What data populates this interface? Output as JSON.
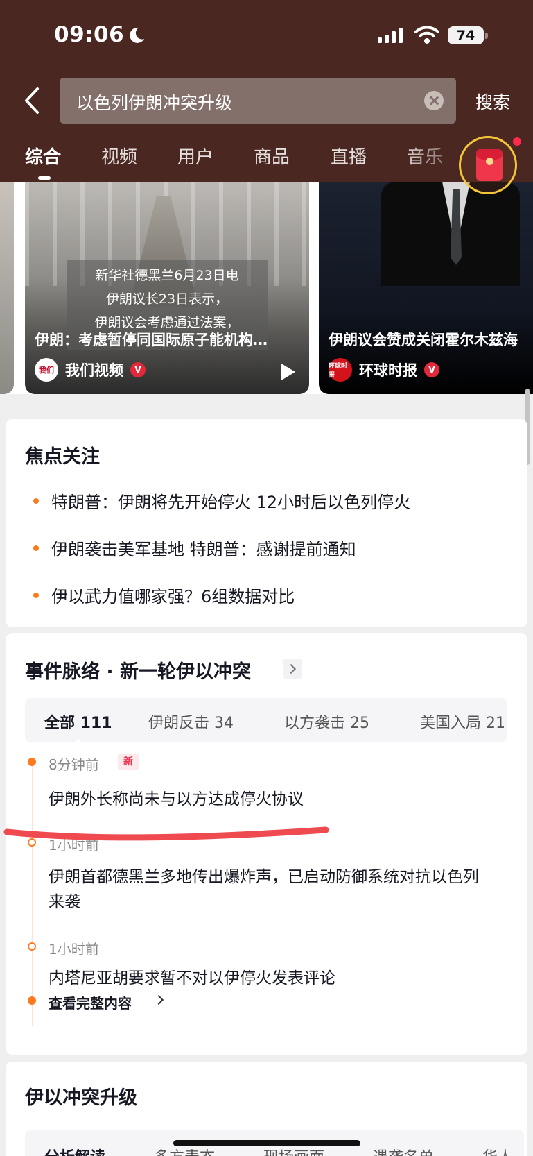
{
  "status_bar": {
    "time": "09:06",
    "battery": "74"
  },
  "search": {
    "query": "以色列伊朗冲突升级",
    "search_label": "搜索"
  },
  "tabs": [
    {
      "label": "综合",
      "active": true
    },
    {
      "label": "视频"
    },
    {
      "label": "用户"
    },
    {
      "label": "商品"
    },
    {
      "label": "直播"
    },
    {
      "label": "音乐"
    }
  ],
  "videos": [
    {
      "subtitles": [
        "新华社德黑兰6月23日电",
        "伊朗议长23日表示，",
        "伊朗议会考虑通过法案，"
      ],
      "title": "伊朗：考虑暂停同国际原子能机构…",
      "author": "我们视频",
      "avatar_text": "我们"
    },
    {
      "title": "伊朗议会赞成关闭霍尔木兹海",
      "author": "环球时报",
      "avatar_text": "环球时报"
    }
  ],
  "focus": {
    "title": "焦点关注",
    "items": [
      "特朗普：伊朗将先开始停火 12小时后以色列停火",
      "伊朗袭击美军基地 特朗普：感谢提前通知",
      "伊以武力值哪家强？6组数据对比"
    ]
  },
  "events": {
    "title": "事件脉络 · 新一轮伊以冲突",
    "tabs": [
      {
        "label": "全部 111",
        "active": true
      },
      {
        "label": "伊朗反击 34"
      },
      {
        "label": "以方袭击 25"
      },
      {
        "label": "美国入局 21"
      }
    ],
    "timeline": [
      {
        "time": "8分钟前",
        "badge": "新",
        "text": "伊朗外长称尚未与以方达成停火协议"
      },
      {
        "time": "1小时前",
        "text": "伊朗首都德黑兰多地传出爆炸声，已启动防御系统对抗以色列来袭"
      },
      {
        "time": "1小时前",
        "text": "内塔尼亚胡要求暂不对以伊停火发表评论"
      }
    ],
    "view_all": "查看完整内容"
  },
  "escalation": {
    "title": "伊以冲突升级",
    "tabs": [
      {
        "label": "分析解读",
        "active": true
      },
      {
        "label": "多方表态"
      },
      {
        "label": "现场画面"
      },
      {
        "label": "遇袭名单"
      },
      {
        "label": "华人"
      }
    ]
  },
  "colors": {
    "header_bg": "#4a2721",
    "accent_orange": "#fe7a1f",
    "annotation_red": "#ef4a4f",
    "verified_red": "#e4283b"
  }
}
